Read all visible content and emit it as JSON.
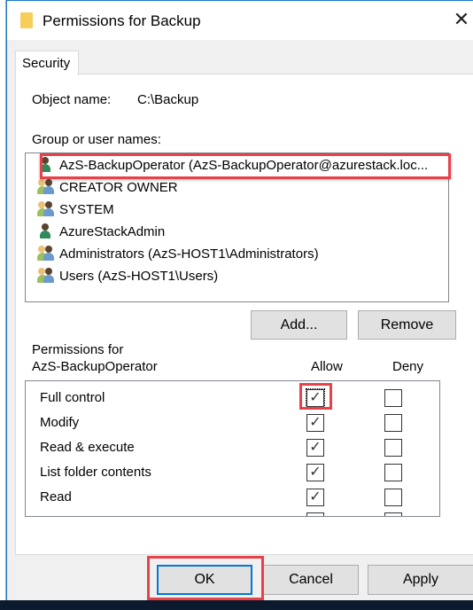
{
  "dialog": {
    "title": "Permissions for Backup",
    "close_icon": "close-icon",
    "folder_icon": "folder-icon"
  },
  "tab": {
    "label": "Security"
  },
  "object": {
    "label": "Object name:",
    "value": "C:\\Backup"
  },
  "group_label": "Group or user names:",
  "users": [
    {
      "name": "AzS-BackupOperator (AzS-BackupOperator@azurestack.loc...",
      "icon": "user-icon"
    },
    {
      "name": "CREATOR OWNER",
      "icon": "group-icon"
    },
    {
      "name": "SYSTEM",
      "icon": "group-icon"
    },
    {
      "name": "AzureStackAdmin",
      "icon": "user-icon"
    },
    {
      "name": "Administrators (AzS-HOST1\\Administrators)",
      "icon": "group-icon"
    },
    {
      "name": "Users (AzS-HOST1\\Users)",
      "icon": "group-icon"
    }
  ],
  "buttons": {
    "add": "Add...",
    "remove": "Remove",
    "ok": "OK",
    "cancel": "Cancel",
    "apply": "Apply"
  },
  "permissions": {
    "label_line1": "Permissions for",
    "label_line2": "AzS-BackupOperator",
    "allow_header": "Allow",
    "deny_header": "Deny",
    "rows": [
      {
        "name": "Full control",
        "allow": true,
        "deny": false
      },
      {
        "name": "Modify",
        "allow": true,
        "deny": false
      },
      {
        "name": "Read & execute",
        "allow": true,
        "deny": false
      },
      {
        "name": "List folder contents",
        "allow": true,
        "deny": false
      },
      {
        "name": "Read",
        "allow": true,
        "deny": false
      }
    ]
  },
  "colors": {
    "highlight": "#e8414a",
    "focus": "#0078d7"
  }
}
